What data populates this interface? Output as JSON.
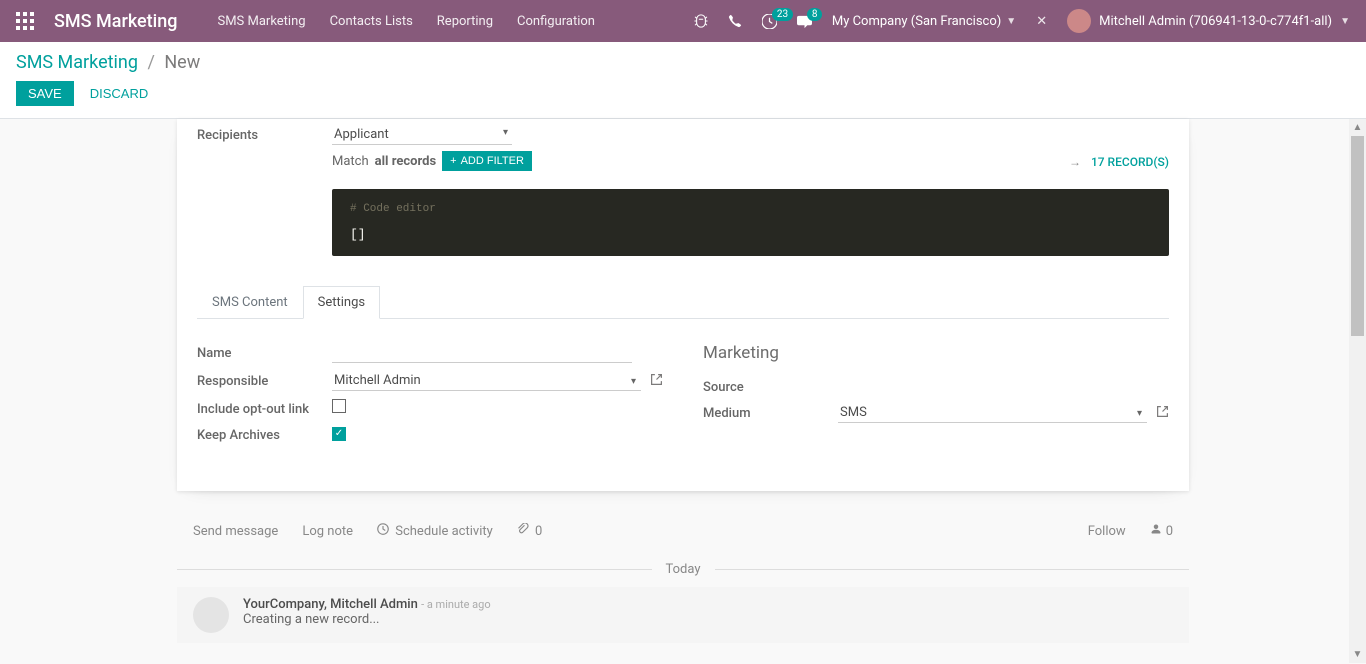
{
  "header": {
    "brand": "SMS Marketing",
    "nav": [
      "SMS Marketing",
      "Contacts Lists",
      "Reporting",
      "Configuration"
    ],
    "activity_badge": "23",
    "discuss_badge": "8",
    "company": "My Company (San Francisco)",
    "user": "Mitchell Admin (706941-13-0-c774f1-all)"
  },
  "breadcrumb": {
    "root": "SMS Marketing",
    "current": "New"
  },
  "buttons": {
    "save": "Save",
    "discard": "Discard"
  },
  "form": {
    "recipients_label": "Recipients",
    "recipients_value": "Applicant",
    "match_prefix": "Match ",
    "match_bold": "all records",
    "add_filter": "Add Filter",
    "records_count": "17 Record(s)",
    "code_comment": "# Code editor",
    "code_body": "[]"
  },
  "tabs": {
    "content": "SMS Content",
    "settings": "Settings"
  },
  "settings": {
    "name_label": "Name",
    "name_value": "",
    "responsible_label": "Responsible",
    "responsible_value": "Mitchell Admin",
    "optout_label": "Include opt-out link",
    "archives_label": "Keep Archives",
    "marketing_title": "Marketing",
    "source_label": "Source",
    "medium_label": "Medium",
    "medium_value": "SMS"
  },
  "chatter": {
    "send": "Send message",
    "lognote": "Log note",
    "schedule": "Schedule activity",
    "attach_count": "0",
    "follow": "Follow",
    "followers_count": "0",
    "day": "Today",
    "msg_author": "YourCompany, Mitchell Admin",
    "msg_time": "- a minute ago",
    "msg_body": "Creating a new record..."
  }
}
